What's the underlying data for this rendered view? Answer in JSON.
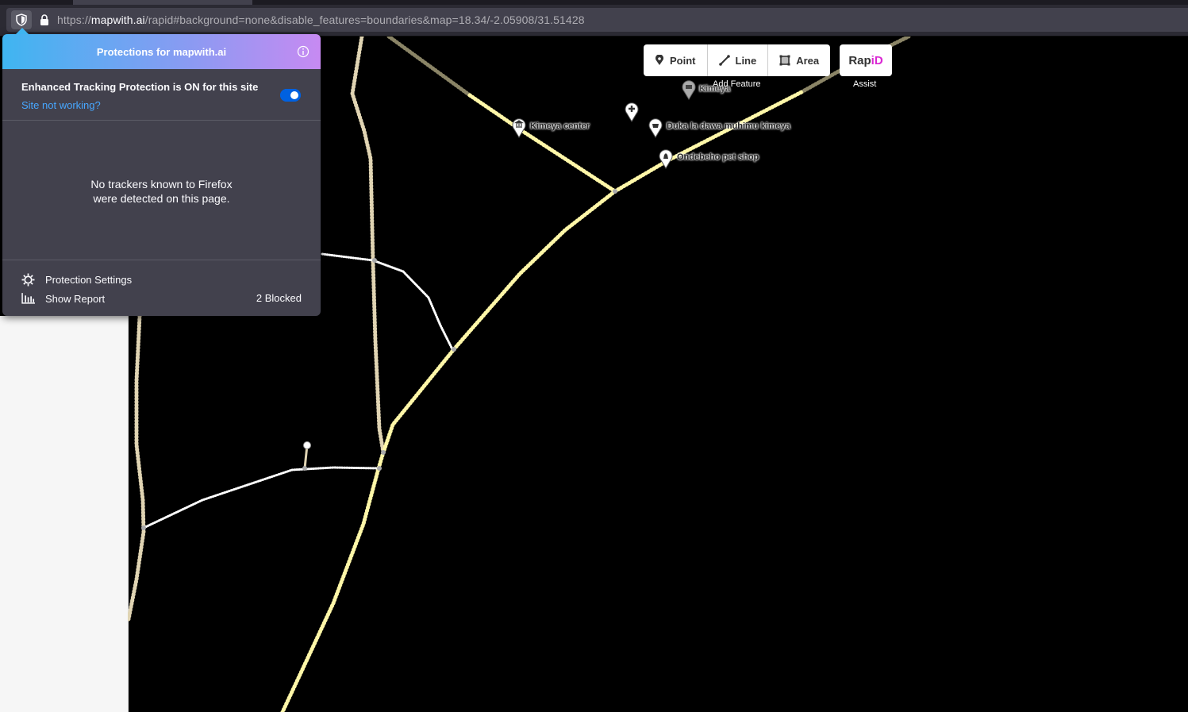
{
  "browser": {
    "url_host": "mapwith.ai",
    "url_prefix": "https://",
    "url_rest": "/rapid#background=none&disable_features=boundaries&map=18.34/-2.05908/31.51428"
  },
  "protections_popup": {
    "title": "Protections for mapwith.ai",
    "etp_label": "Enhanced Tracking Protection is ON for this site",
    "etp_enabled": true,
    "site_not_working_link": "Site not working?",
    "empty_message_line1": "No trackers known to Firefox",
    "empty_message_line2": "were detected on this page.",
    "settings_label": "Protection Settings",
    "report_label": "Show Report",
    "blocked_count": "2 Blocked"
  },
  "editor_toolbar": {
    "point_label": "Point",
    "line_label": "Line",
    "area_label": "Area",
    "add_feature_caption": "Add Feature",
    "rapid_logo_prefix": "Rap",
    "rapid_logo_suffix": "iD",
    "assist_caption": "Assist"
  },
  "map_labels": {
    "kimeya": "Kimeya",
    "kimeya_center": "Kimeya center",
    "duka": "Duka la dawa muhimu kimeya",
    "pet_shop": "Ondebeho pet shop"
  },
  "colors": {
    "primary_road": "#fff7a8",
    "track": "#e0d4b3",
    "path": "#ffffff",
    "toggle_on": "#0061e0",
    "rapid_accent": "#da26d3"
  }
}
